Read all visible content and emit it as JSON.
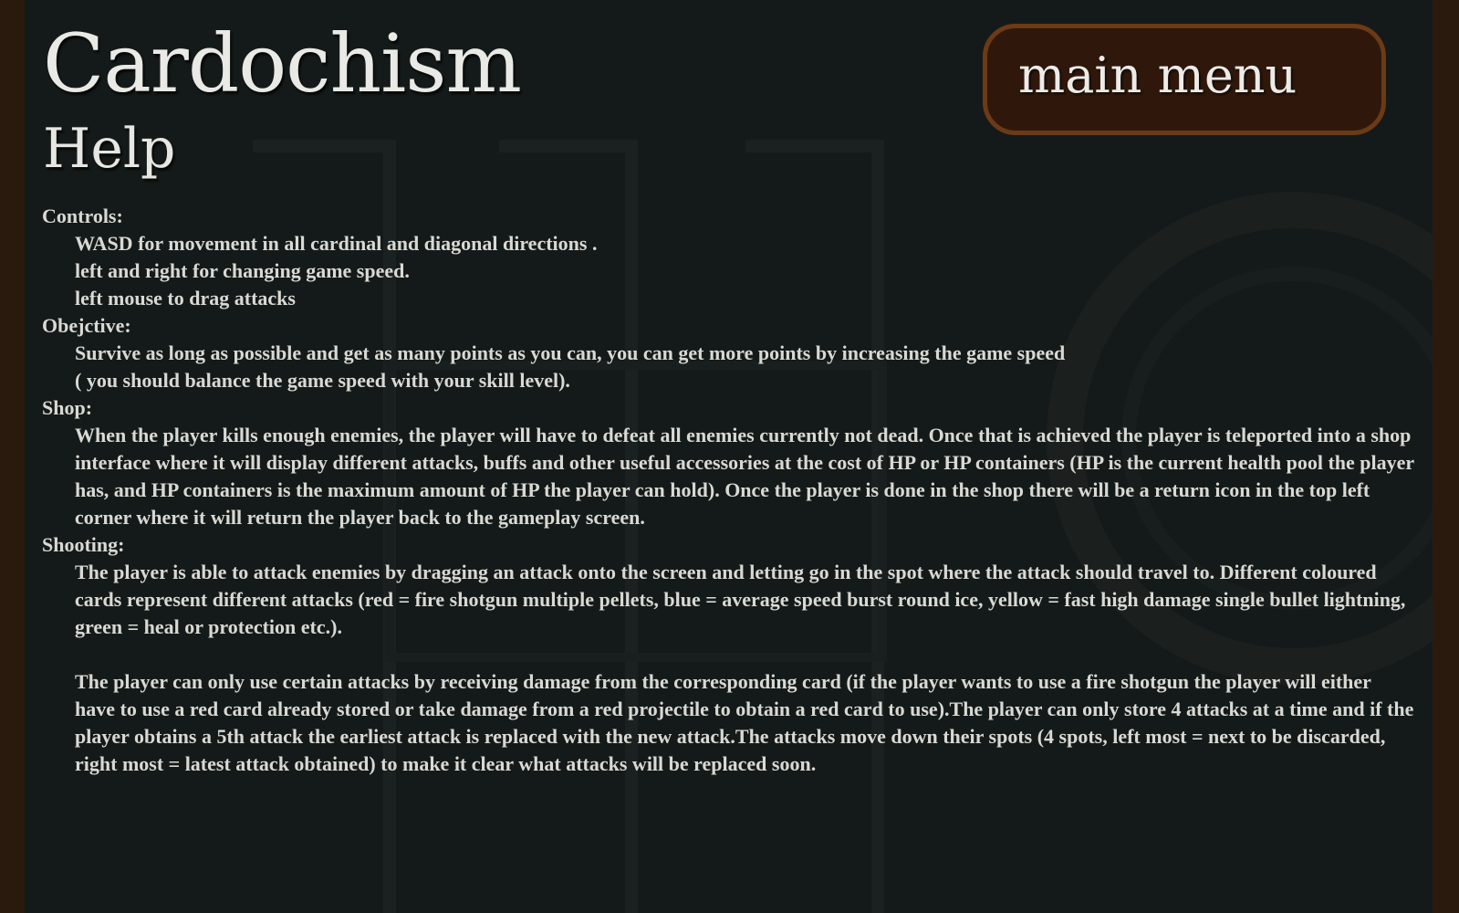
{
  "header": {
    "title": "Cardochism",
    "subtitle": "Help"
  },
  "menu_button": {
    "label": "main menu"
  },
  "sections": {
    "controls": {
      "heading": "Controls:",
      "lines": [
        "WASD for movement in all cardinal and diagonal directions .",
        "left and right for changing game speed.",
        "left mouse to drag attacks"
      ]
    },
    "objective": {
      "heading": "Obejctive:",
      "lines": [
        "Survive as long as possible and get as many points as you can, you can get more points by increasing the game speed",
        "( you should balance the game speed with your skill level)."
      ]
    },
    "shop": {
      "heading": "Shop:",
      "text": "When the player kills enough enemies, the player will have to defeat all enemies currently not dead. Once that is achieved the player is teleported into a shop interface where it will display different attacks, buffs and other useful accessories at the cost of HP or HP containers (HP is the current health pool the player has, and HP containers is the maximum amount of HP the player can hold). Once the player is done in the shop there will be a return icon in the top left corner where it will return the player back to the gameplay screen."
    },
    "shooting": {
      "heading": "Shooting:",
      "text1": "The player is able to attack enemies by dragging an attack onto the screen and letting go in the spot where the attack should travel to. Different coloured cards represent different attacks (red = fire shotgun multiple pellets, blue = average speed burst round ice, yellow = fast high damage single bullet lightning, green = heal or protection etc.).",
      "text2": "The player can only use certain attacks by receiving damage from the corresponding card (if the player wants to use a fire shotgun the player will either have to use a red card already stored or take damage from a red projectile to obtain a red card to use).The player can only store 4 attacks at a time and if the player obtains a 5th attack the earliest attack is replaced with the new attack.The attacks move down their spots (4 spots, left most = next to be discarded, right most = latest attack obtained) to make it clear what attacks will be replaced soon."
    }
  },
  "colors": {
    "side_border": "#2a1a0e",
    "background": "#141a19",
    "button_fill": "#2f180b",
    "button_border": "#6b3a16",
    "text": "#d9d9d4"
  }
}
